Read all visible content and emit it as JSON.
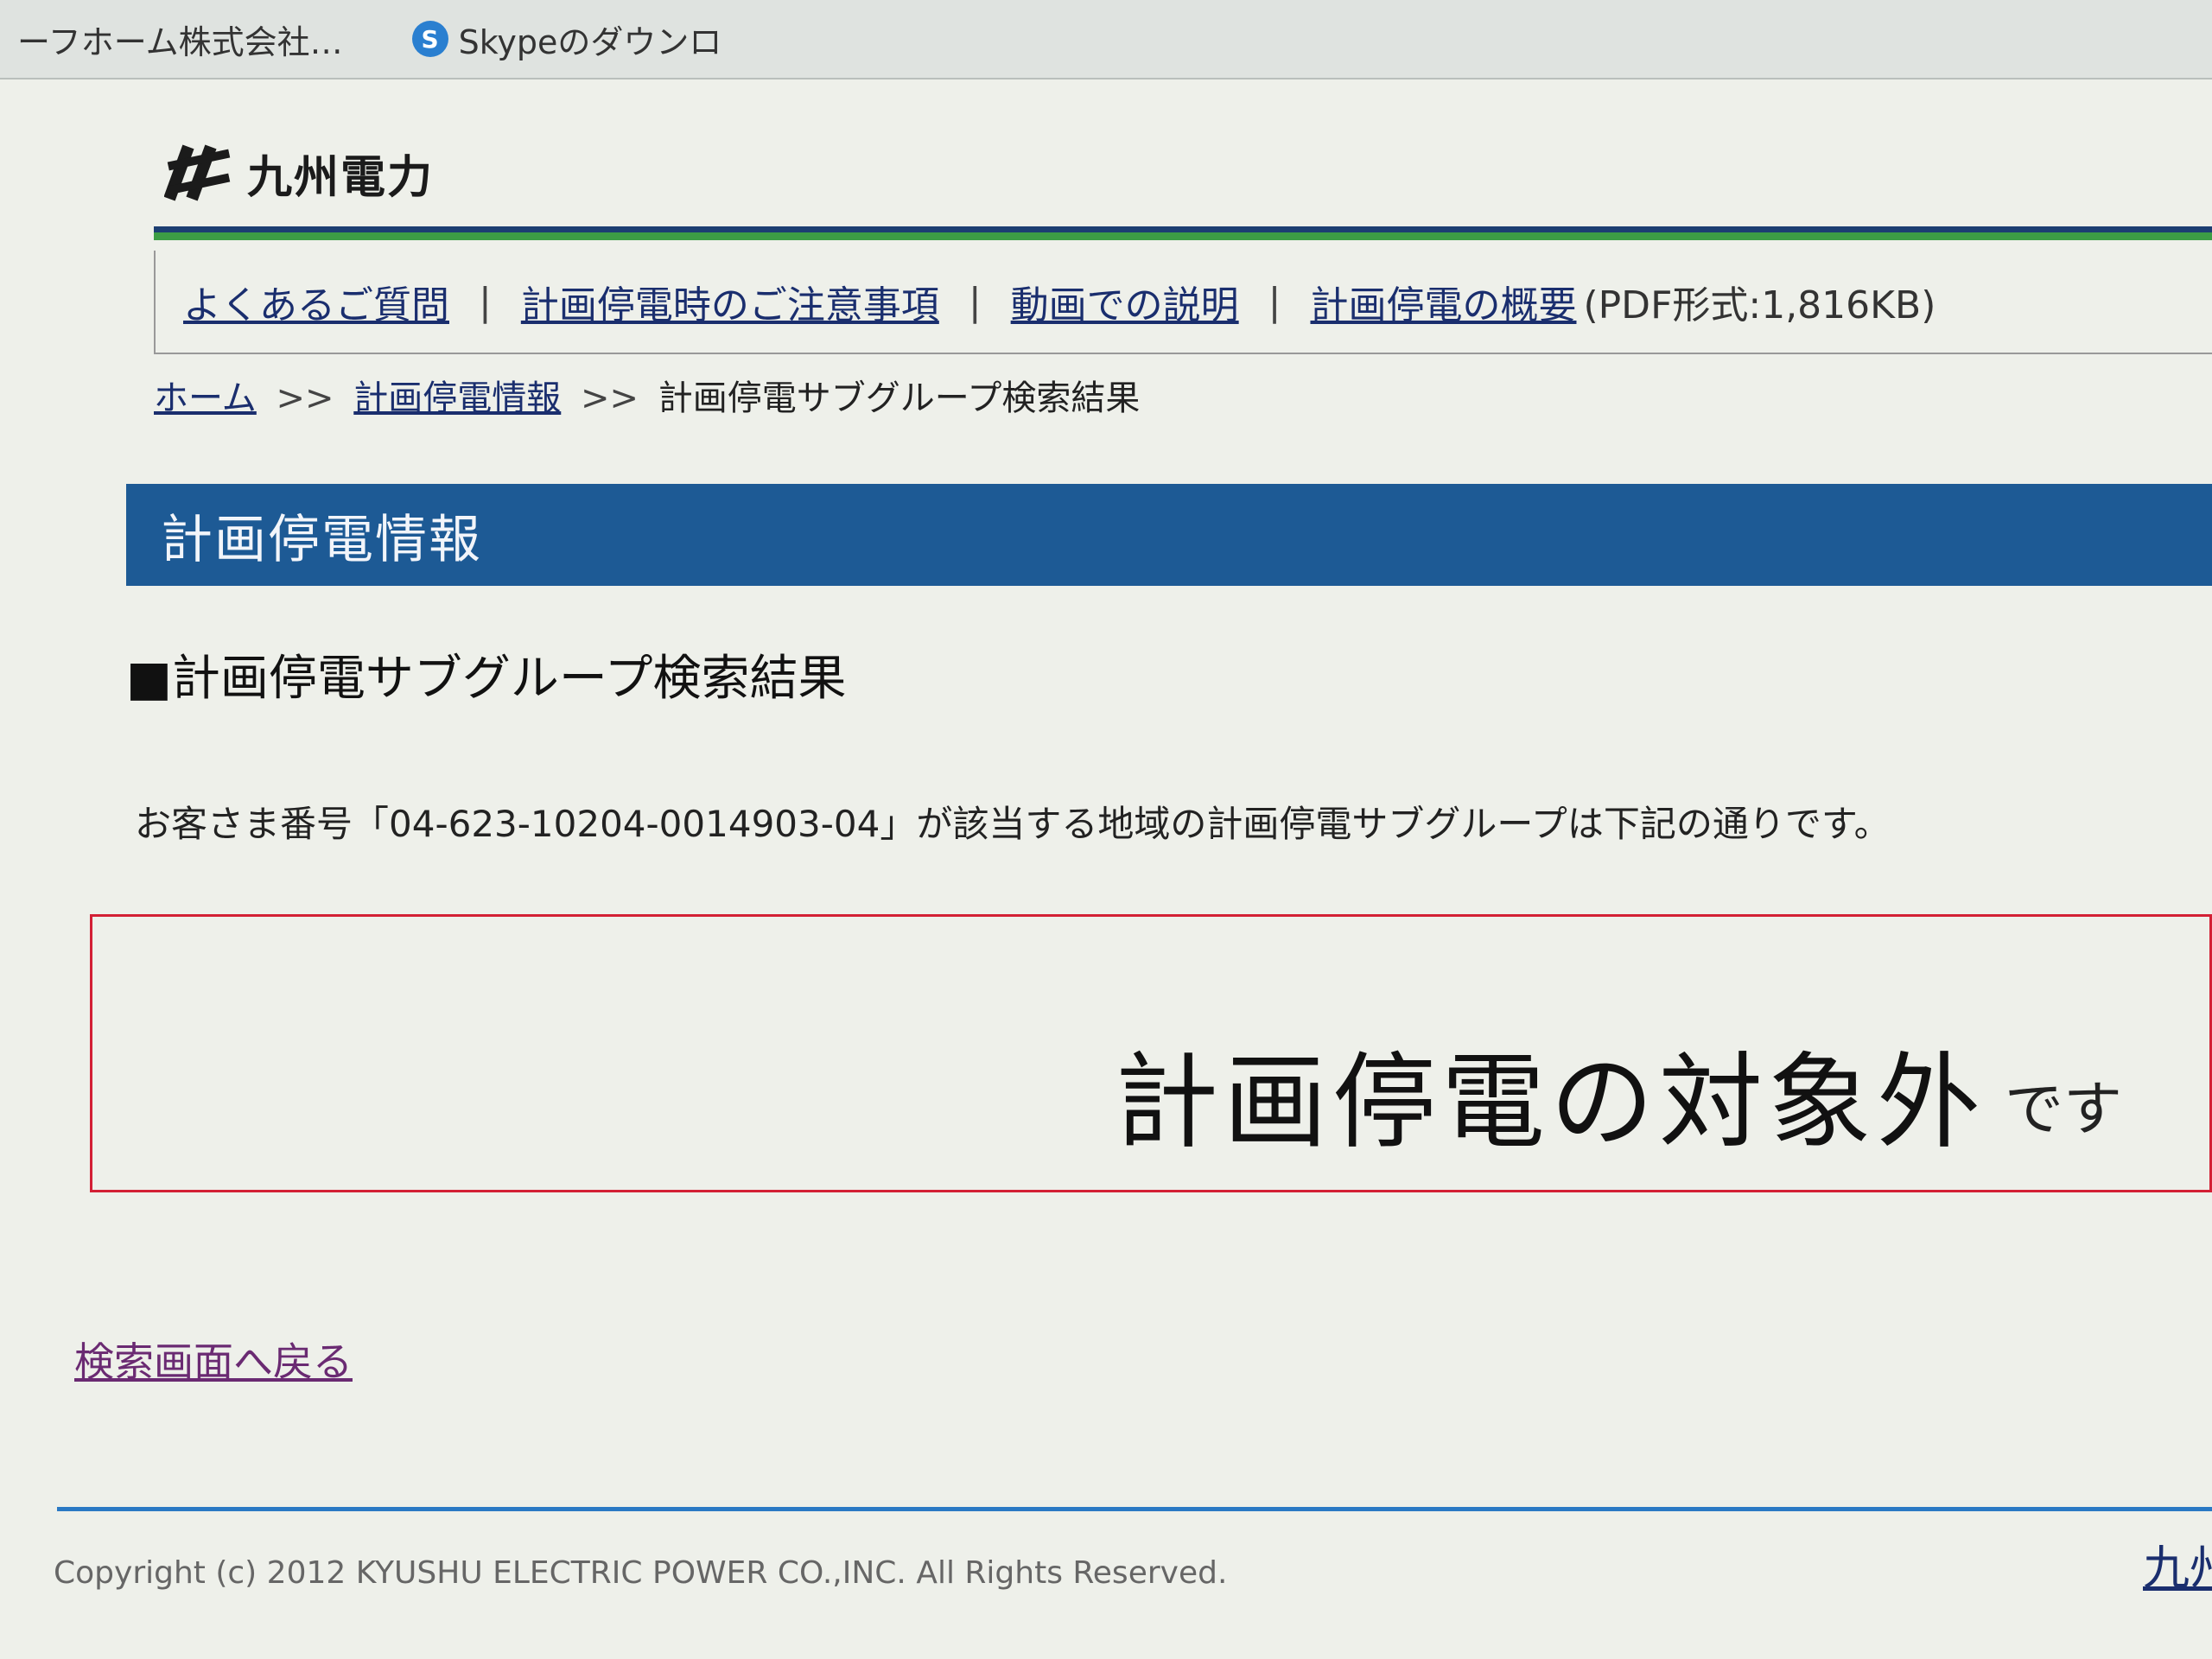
{
  "browser": {
    "tabs": [
      {
        "label": "ーフホーム株式会社…",
        "icon": ""
      },
      {
        "label": "Skypeのダウンロ",
        "icon": "S"
      }
    ]
  },
  "header": {
    "logo_icon": "kyushu-electric-logo-icon",
    "logo_text": "九州電力",
    "brand_colors": {
      "navy": "#1c3e72",
      "green": "#3c9d45"
    }
  },
  "subnav": {
    "faq": "よくあるご質問",
    "sep1": "|",
    "notes": "計画停電時のご注意事項",
    "sep2": "|",
    "video": "動画での説明",
    "sep3": "|",
    "overview": "計画停電の概要",
    "overview_note": "(PDF形式:1,816KB)"
  },
  "breadcrumb": {
    "home": "ホーム",
    "sep1": ">>",
    "info": "計画停電情報",
    "sep2": ">>",
    "current": "計画停電サブグループ検索結果"
  },
  "page": {
    "title": "計画停電情報",
    "section_heading": "■計画停電サブグループ検索結果",
    "result_text": "お客さま番号「04-623-10204-0014903-04」が該当する地域の計画停電サブグループは下記の通りです。",
    "result_main": "計画停電の対象外",
    "result_suffix": "です",
    "back_link": "検索画面へ戻る",
    "accent_color": "#1d5a95",
    "box_color": "#d32035"
  },
  "footer": {
    "copyright": "Copyright (c) 2012 KYUSHU ELECTRIC POWER CO.,INC. All Rights Reserved.",
    "right_link": "九州"
  }
}
